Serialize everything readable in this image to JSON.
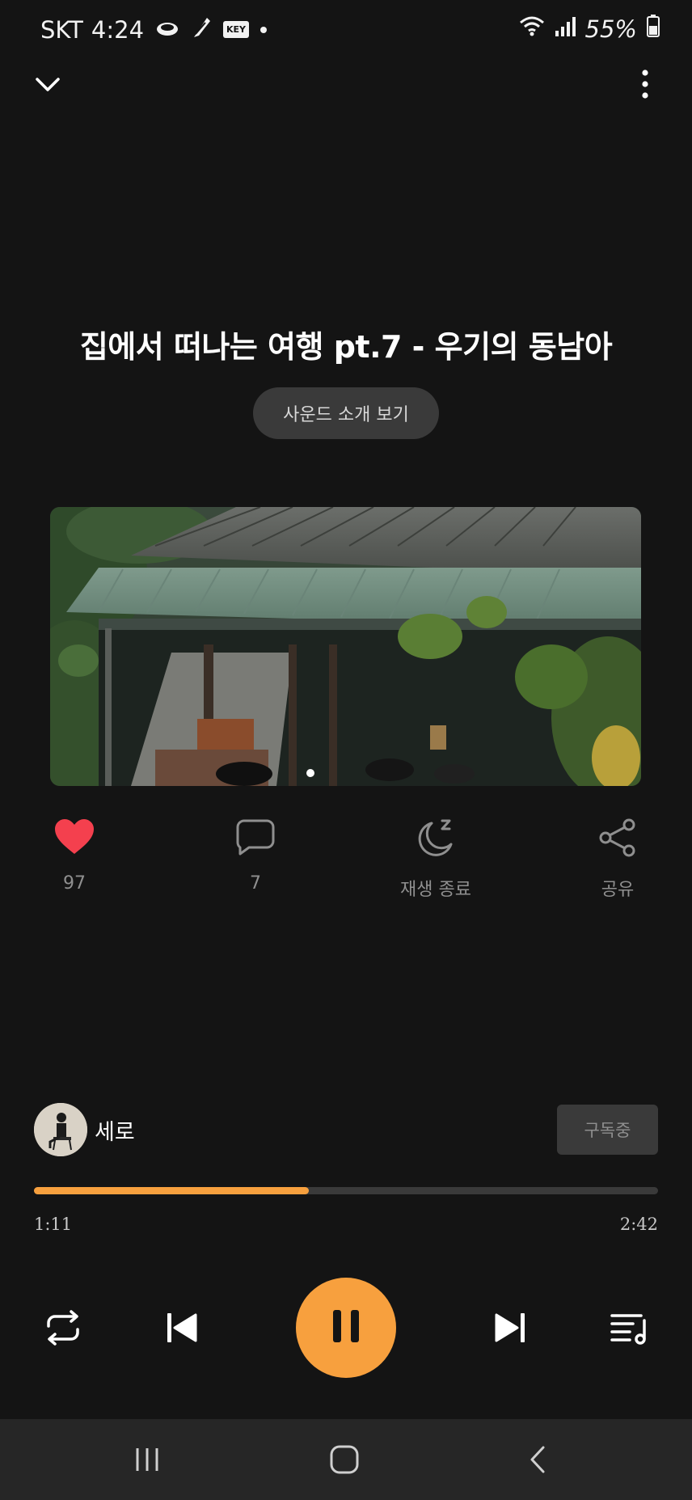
{
  "status_bar": {
    "carrier": "SKT",
    "time": "4:24",
    "key_badge": "KEY",
    "battery": "55%"
  },
  "track": {
    "title": "집에서 떠나는 여행 pt.7 - 우기의 동남아",
    "intro_button": "사운드 소개 보기"
  },
  "actions": {
    "like_count": "97",
    "comment_count": "7",
    "sleep_timer_label": "재생 종료",
    "share_label": "공유"
  },
  "artist": {
    "name": "세로",
    "subscribe_label": "구독중"
  },
  "playback": {
    "elapsed": "1:11",
    "duration": "2:42",
    "progress_fraction": 0.44
  },
  "colors": {
    "accent": "#f7a03e",
    "background": "#141414",
    "like": "#f4404e"
  },
  "icons": {
    "collapse": "chevron-down-icon",
    "more": "more-vertical-icon",
    "like": "heart-icon",
    "comment": "comment-icon",
    "sleep": "moon-icon",
    "share": "share-icon",
    "repeat": "repeat-icon",
    "previous": "skip-previous-icon",
    "pause": "pause-icon",
    "next": "skip-next-icon",
    "playlist": "playlist-icon"
  }
}
